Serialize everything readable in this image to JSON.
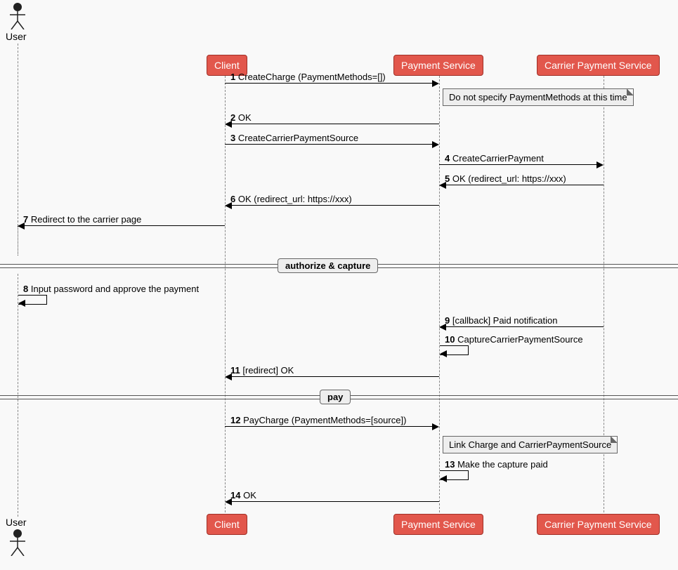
{
  "participants": {
    "user": "User",
    "client": "Client",
    "payment_service": "Payment Service",
    "carrier_payment_service": "Carrier  Payment Service"
  },
  "messages": {
    "m1": {
      "n": "1",
      "t": "CreateCharge (PaymentMethods=[])"
    },
    "m2": {
      "n": "2",
      "t": "OK"
    },
    "m3": {
      "n": "3",
      "t": "CreateCarrierPaymentSource"
    },
    "m4": {
      "n": "4",
      "t": "CreateCarrierPayment"
    },
    "m5": {
      "n": "5",
      "t": "OK (redirect_url: https://xxx)"
    },
    "m6": {
      "n": "6",
      "t": "OK (redirect_url: https://xxx)"
    },
    "m7": {
      "n": "7",
      "t": "Redirect to the carrier page"
    },
    "m8": {
      "n": "8",
      "t": "Input password and approve the payment"
    },
    "m9": {
      "n": "9",
      "t": "[callback] Paid notification"
    },
    "m10": {
      "n": "10",
      "t": "CaptureCarrierPaymentSource"
    },
    "m11": {
      "n": "11",
      "t": "[redirect] OK"
    },
    "m12": {
      "n": "12",
      "t": "PayCharge (PaymentMethods=[source])"
    },
    "m13": {
      "n": "13",
      "t": "Make the capture paid"
    },
    "m14": {
      "n": "14",
      "t": "OK"
    }
  },
  "notes": {
    "n1": "Do not specify PaymentMethods at this time",
    "n2": "Link Charge and CarrierPaymentSource"
  },
  "dividers": {
    "d1": "authorize & capture",
    "d2": "pay"
  },
  "chart_data": {
    "type": "sequence-diagram",
    "participants": [
      "User",
      "Client",
      "Payment Service",
      "Carrier  Payment Service"
    ],
    "interactions": [
      {
        "seq": 1,
        "from": "Client",
        "to": "Payment Service",
        "label": "CreateCharge (PaymentMethods=[])",
        "note": "Do not specify PaymentMethods at this time"
      },
      {
        "seq": 2,
        "from": "Payment Service",
        "to": "Client",
        "label": "OK"
      },
      {
        "seq": 3,
        "from": "Client",
        "to": "Payment Service",
        "label": "CreateCarrierPaymentSource"
      },
      {
        "seq": 4,
        "from": "Payment Service",
        "to": "Carrier  Payment Service",
        "label": "CreateCarrierPayment"
      },
      {
        "seq": 5,
        "from": "Carrier  Payment Service",
        "to": "Payment Service",
        "label": "OK (redirect_url: https://xxx)"
      },
      {
        "seq": 6,
        "from": "Payment Service",
        "to": "Client",
        "label": "OK (redirect_url: https://xxx)"
      },
      {
        "seq": 7,
        "from": "Client",
        "to": "User",
        "label": "Redirect to the carrier page"
      },
      {
        "divider": "authorize & capture"
      },
      {
        "seq": 8,
        "from": "User",
        "to": "User",
        "label": "Input password and approve the payment",
        "self": true
      },
      {
        "seq": 9,
        "from": "Carrier  Payment Service",
        "to": "Payment Service",
        "label": "[callback] Paid notification"
      },
      {
        "seq": 10,
        "from": "Payment Service",
        "to": "Payment Service",
        "label": "CaptureCarrierPaymentSource",
        "self": true
      },
      {
        "seq": 11,
        "from": "Payment Service",
        "to": "Client",
        "label": "[redirect] OK"
      },
      {
        "divider": "pay"
      },
      {
        "seq": 12,
        "from": "Client",
        "to": "Payment Service",
        "label": "PayCharge (PaymentMethods=[source])",
        "note": "Link Charge and CarrierPaymentSource"
      },
      {
        "seq": 13,
        "from": "Payment Service",
        "to": "Payment Service",
        "label": "Make the capture paid",
        "self": true
      },
      {
        "seq": 14,
        "from": "Payment Service",
        "to": "Client",
        "label": "OK"
      }
    ]
  }
}
